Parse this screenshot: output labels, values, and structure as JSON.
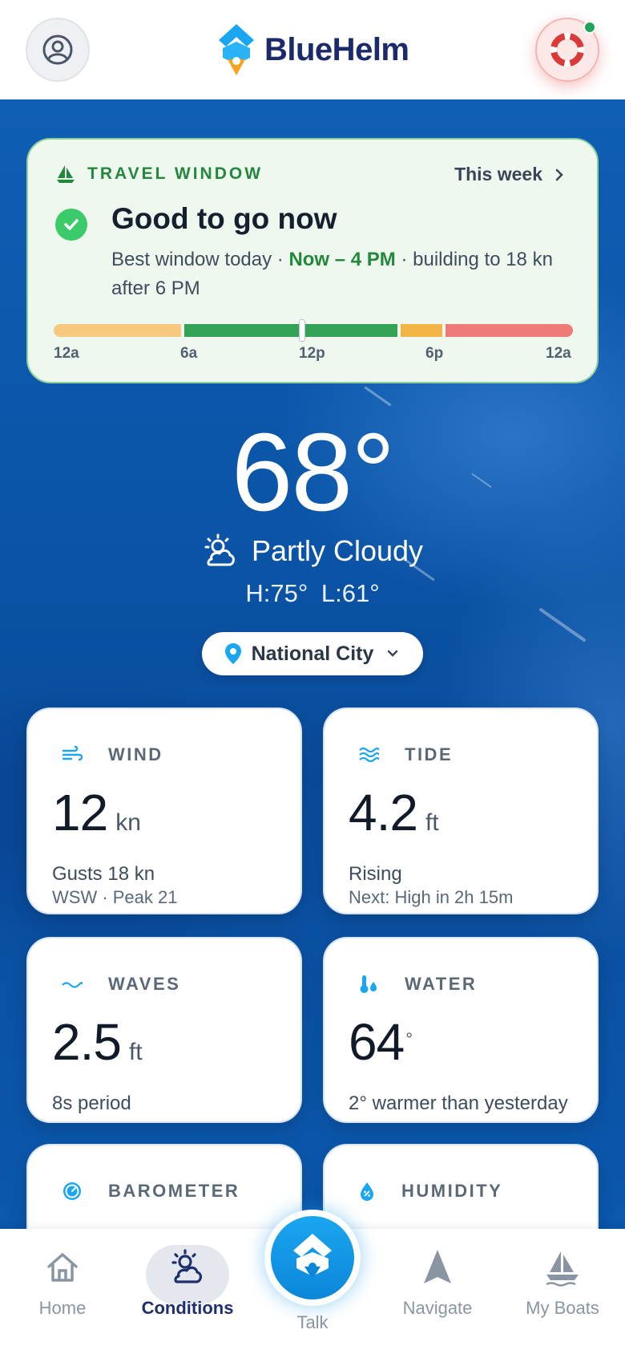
{
  "app": {
    "brand": "BlueHelm"
  },
  "travel_window": {
    "label": "TRAVEL WINDOW",
    "week_link": "This week",
    "status": "Good to go now",
    "desc_prefix": "Best window today · ",
    "desc_highlight": "Now – 4 PM",
    "desc_suffix": " · building to 18 kn after 6 PM",
    "ticks": [
      "12a",
      "6a",
      "12p",
      "6p",
      "12a"
    ],
    "colors": {
      "fair": "#f7c97e",
      "good": "#34a357",
      "moderate": "#f4b548",
      "poor": "#ee7b78"
    }
  },
  "current": {
    "temperature": "68°",
    "condition": "Partly Cloudy",
    "hilo": "H:75° L:61°",
    "location": "National City"
  },
  "metrics": {
    "wind": {
      "label": "WIND",
      "value": "12",
      "unit": "kn",
      "line1": "Gusts 18 kn",
      "line2": "WSW · Peak 21"
    },
    "tide": {
      "label": "TIDE",
      "value": "4.2",
      "unit": "ft",
      "line1": "Rising",
      "line2": "Next: High in 2h 15m"
    },
    "waves": {
      "label": "WAVES",
      "value": "2.5",
      "unit": "ft",
      "line1": "8s period"
    },
    "water": {
      "label": "WATER",
      "value": "64",
      "unit": "°",
      "line1": "2° warmer than yesterday"
    },
    "barometer": {
      "label": "BAROMETER"
    },
    "humidity": {
      "label": "HUMIDITY"
    }
  },
  "nav": {
    "home": "Home",
    "conditions": "Conditions",
    "talk": "Talk",
    "navigate": "Navigate",
    "boats": "My Boats"
  },
  "colors": {
    "accent": "#1aa6f0",
    "brand": "#1b2a6b",
    "go_green": "#22883a"
  }
}
